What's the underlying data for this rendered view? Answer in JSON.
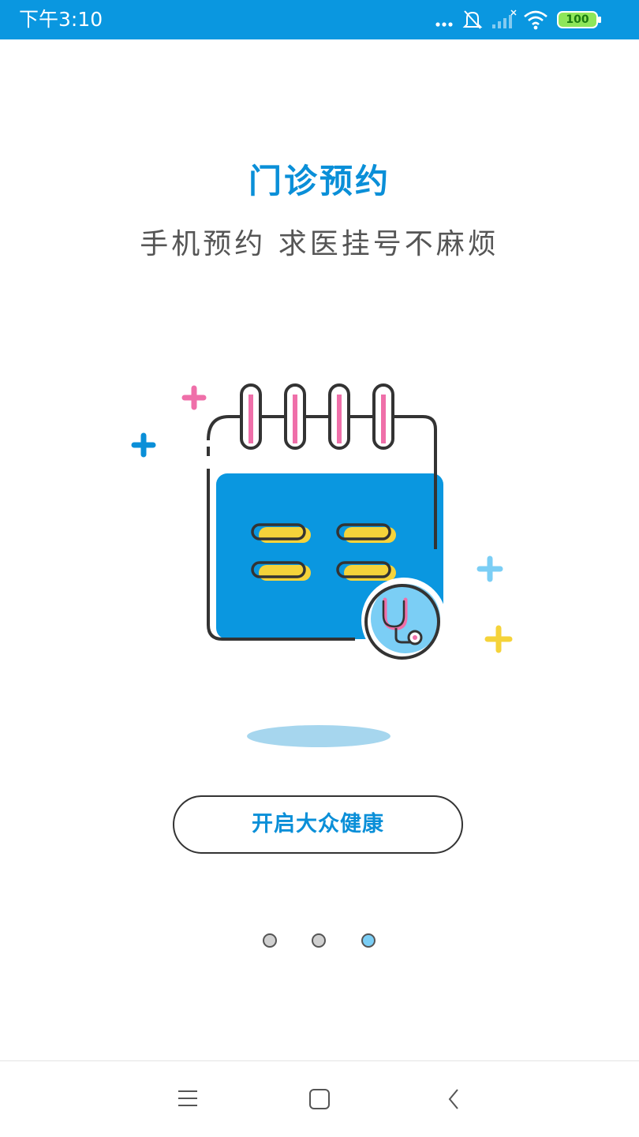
{
  "status_bar": {
    "time": "下午3:10",
    "battery": "100",
    "bg_color": "#0a97e0",
    "icons": [
      "more-dots-icon",
      "mute-bell-icon",
      "signal-icon",
      "wifi-icon",
      "battery-icon"
    ]
  },
  "onboarding": {
    "title": "门诊预约",
    "subtitle": "手机预约 求医挂号不麻烦",
    "start_button_label": "开启大众健康",
    "total_pages": 3,
    "active_page": 3,
    "illustration_icons": [
      "calendar-icon",
      "stethoscope-icon",
      "plus-icon"
    ]
  },
  "colors": {
    "accent": "#0a8fd8",
    "dot_inactive": "#d0d0d0",
    "dot_active": "#7bcef5",
    "pink": "#ef6fa9",
    "yellow": "#f5d33a"
  },
  "nav_bar": {
    "icons": [
      "menu-icon",
      "home-icon",
      "back-icon"
    ]
  }
}
